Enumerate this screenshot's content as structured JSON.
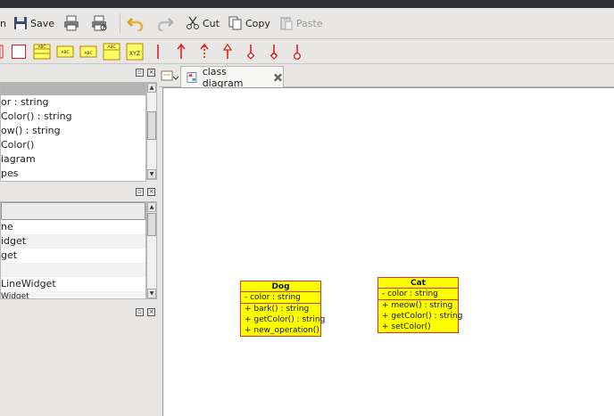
{
  "toolbar": {
    "partial_left": "n",
    "save_label": "Save",
    "cut_label": "Cut",
    "copy_label": "Copy",
    "paste_label": "Paste"
  },
  "shape_tools": {
    "labels": [
      "ABC",
      "ABC",
      "ABC",
      "ABC",
      "XYZ"
    ]
  },
  "panel1": {
    "rows": [
      "or : string",
      "Color() : string",
      "ow() : string",
      "Color()",
      "iagram",
      "pes"
    ]
  },
  "panel2": {
    "rows": [
      "ne",
      "idget",
      "get",
      "",
      "LineWidget",
      "Widget"
    ]
  },
  "tab": {
    "label": "class diagram"
  },
  "diagram": {
    "dog": {
      "name": "Dog",
      "attributes": [
        "- color : string"
      ],
      "operations": [
        "+ bark() : string",
        "+ getColor() : string",
        "+ new_operation()"
      ]
    },
    "cat": {
      "name": "Cat",
      "attributes": [
        "- color : string"
      ],
      "operations": [
        "+ meow() : string",
        "+ getColor() : string",
        "+ setColor()"
      ]
    }
  },
  "colors": {
    "class_fill": "#ffff00",
    "class_border": "#e0303a",
    "tool_red": "#e02020"
  }
}
